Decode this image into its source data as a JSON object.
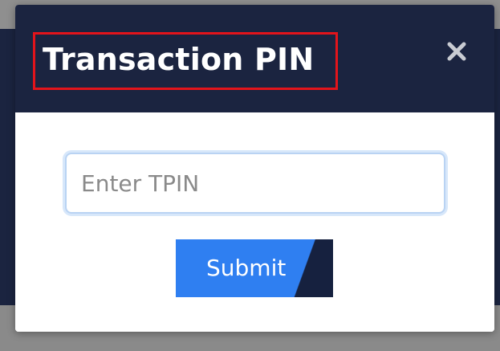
{
  "modal": {
    "title": "Transaction PIN",
    "close_icon": "close-icon",
    "input": {
      "placeholder": "Enter TPIN",
      "value": ""
    },
    "submit_label": "Submit"
  },
  "colors": {
    "header_bg": "#1b2440",
    "title_border": "#e3141b",
    "submit_bg": "#2f7ff1",
    "submit_accent": "#16213f",
    "close_icon": "#c9ccd3"
  }
}
